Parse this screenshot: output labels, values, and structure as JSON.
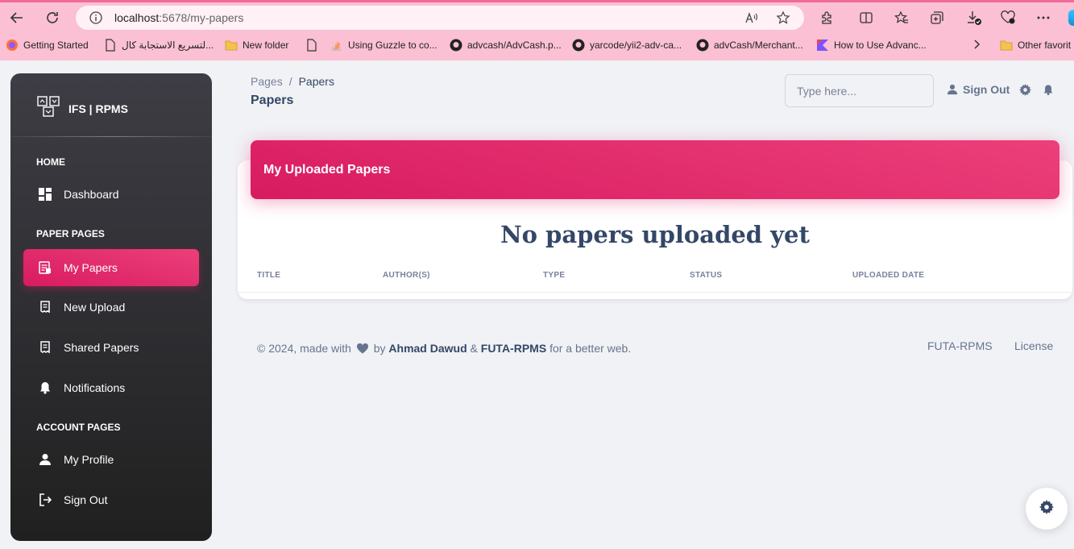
{
  "browser": {
    "url_host": "localhost",
    "url_rest": ":5678/my-papers",
    "bookmarks": [
      "Getting Started",
      "لتسريع الاستجابة كال...",
      "New folder",
      "Using Guzzle to co...",
      "advcash/AdvCash.p...",
      "yarcode/yii2-adv-ca...",
      "advCash/Merchant...",
      "How to Use Advanc...",
      "Other favorit"
    ]
  },
  "sidebar": {
    "brand": "IFS | RPMS",
    "sections": {
      "home": "HOME",
      "paper_pages": "PAPER PAGES",
      "account_pages": "ACCOUNT PAGES"
    },
    "items": [
      {
        "label": "Dashboard",
        "icon": "dashboard-icon"
      },
      {
        "label": "My Papers",
        "icon": "papers-icon",
        "active": true
      },
      {
        "label": "New Upload",
        "icon": "receipt-icon"
      },
      {
        "label": "Shared Papers",
        "icon": "receipt-icon"
      },
      {
        "label": "Notifications",
        "icon": "bell-icon"
      },
      {
        "label": "My Profile",
        "icon": "person-icon"
      },
      {
        "label": "Sign Out",
        "icon": "logout-icon"
      }
    ]
  },
  "header": {
    "breadcrumb_root": "Pages",
    "breadcrumb_current": "Papers",
    "page_title": "Papers",
    "search_placeholder": "Type here...",
    "sign_out": "Sign Out"
  },
  "card": {
    "title": "My Uploaded Papers",
    "empty_message": "No papers uploaded yet",
    "columns": [
      "TITLE",
      "AUTHOR(S)",
      "TYPE",
      "STATUS",
      "UPLOADED DATE"
    ]
  },
  "footer": {
    "prefix": "© 2024, made with",
    "by": "by",
    "author": "Ahmad Dawud",
    "amp": "&",
    "org": "FUTA-RPMS",
    "suffix": "for a better web.",
    "links": [
      "FUTA-RPMS",
      "License"
    ]
  },
  "colors": {
    "accent": "#e91e63",
    "sidebar_dark": "#202020",
    "text_dark": "#344767",
    "browser_chrome": "#fbc0d3"
  }
}
